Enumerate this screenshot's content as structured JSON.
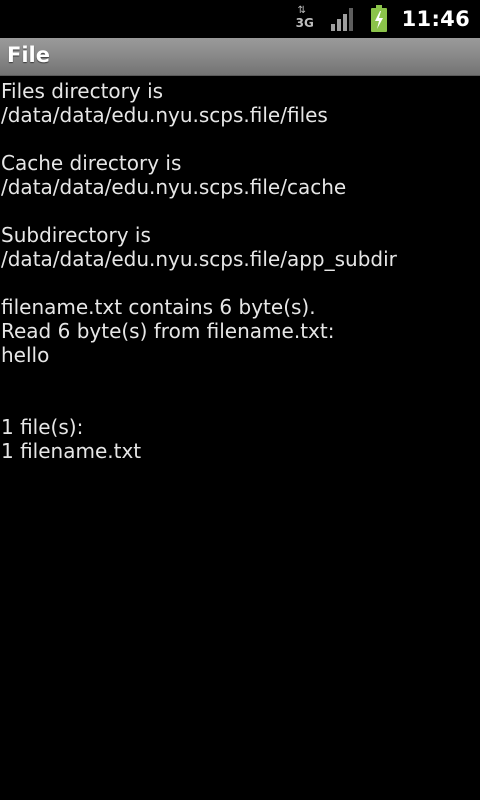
{
  "status_bar": {
    "network_type": "3G",
    "network_arrows": "⇅",
    "time": "11:46",
    "icons": [
      "network-3g-icon",
      "signal-strength-icon",
      "battery-charging-icon"
    ],
    "battery_color": "#8bc34a"
  },
  "title_bar": {
    "title": "File"
  },
  "content": {
    "lines": [
      "Files directory is",
      "/data/data/edu.nyu.scps.file/files",
      "",
      "Cache directory is",
      "/data/data/edu.nyu.scps.file/cache",
      "",
      "Subdirectory is",
      "/data/data/edu.nyu.scps.file/app_subdir",
      "",
      "filename.txt contains 6 byte(s).",
      "Read 6 byte(s) from filename.txt:",
      "hello",
      "",
      "",
      "1 file(s):",
      "1 filename.txt"
    ]
  }
}
